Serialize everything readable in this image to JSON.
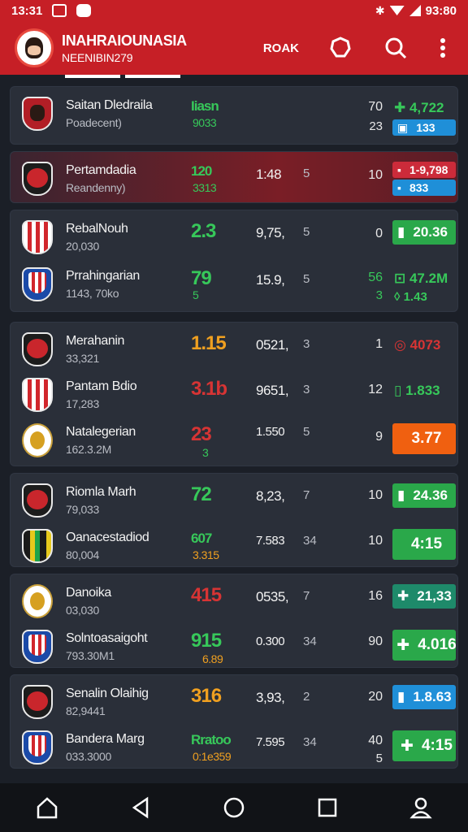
{
  "status_bar": {
    "time": "13:31",
    "right_time": "93:80"
  },
  "app_bar": {
    "title": "INAHRAIOUNASIA",
    "subtitle": "NEENIBIN279",
    "action_label": "ROAK",
    "icons": [
      "shield-icon",
      "search-icon",
      "more-vert-icon"
    ]
  },
  "rows": [
    {
      "name": "Saitan Dledraila",
      "sub": "Poadecent)",
      "score": "Iiasn",
      "score2": "9033",
      "mid": "",
      "mid2": "",
      "n1": "70",
      "n2": "23",
      "b1": "4,722",
      "b2": "133"
    },
    {
      "name": "Pertamdadia",
      "sub": "Reandenny)",
      "score": "120",
      "score2": "3313",
      "mid": "1:48",
      "mid2": "5",
      "n1": "10",
      "b1": "1-9,798",
      "b2": "833"
    },
    {
      "name": "RebalNouh",
      "sub": "20,030",
      "score": "2.3",
      "mid": "9,75,",
      "mid2": "5",
      "n1": "0",
      "b1": "20.36"
    },
    {
      "name": "Prrahingarian",
      "sub": "1143, 70ko",
      "score": "79",
      "score2": "5",
      "mid": "15.9,",
      "mid2": "5",
      "n1": "56",
      "n2": "3",
      "b1": "47.2M",
      "b2": "1.43"
    },
    {
      "name": "Merahanin",
      "sub": "33,321",
      "score": "1.15",
      "mid": "0521,",
      "mid2": "3",
      "n1": "1",
      "b1": "4073"
    },
    {
      "name": "Pantam Bdio",
      "sub": "17,283",
      "score": "3.1b",
      "mid": "9651,",
      "mid2": "3",
      "n1": "12",
      "b1": "1.833"
    },
    {
      "name": "Natalegerian",
      "sub": "162.3.2M",
      "score": "23",
      "score2": "3",
      "mid": "1.550",
      "mid2": "5",
      "n1": "9",
      "b1": "3.77"
    },
    {
      "name": "Riomla Marh",
      "sub": "79,033",
      "score": "72",
      "mid": "8,23,",
      "mid2": "7",
      "n1": "10",
      "b1": "24.36"
    },
    {
      "name": "Oanacestadiod",
      "sub": "80,004",
      "score": "607",
      "score2": "3.315",
      "mid": "7.583",
      "mid2": "34",
      "n1": "10",
      "b1": "4:15"
    },
    {
      "name": "Danoika",
      "sub": "03,030",
      "score": "415",
      "mid": "0535,",
      "mid2": "7",
      "n1": "16",
      "b1": "21,33"
    },
    {
      "name": "Solntoasaigoht",
      "sub": "793.30M1",
      "score": "915",
      "score2": "6.89",
      "mid": "0.300",
      "mid2": "34",
      "n1": "90",
      "b1": "4.016"
    },
    {
      "name": "Senalin Olaihig",
      "sub": "82,9441",
      "score": "316",
      "mid": "3,93,",
      "mid2": "2",
      "n1": "20",
      "b1": "1.8.63"
    },
    {
      "name": "Bandera Marg",
      "sub": "033.3000",
      "score": "Rratoo",
      "score2": "0:1e359",
      "mid": "7.595",
      "mid2": "34",
      "n1": "40",
      "n2": "5",
      "b1": "4:15"
    }
  ]
}
